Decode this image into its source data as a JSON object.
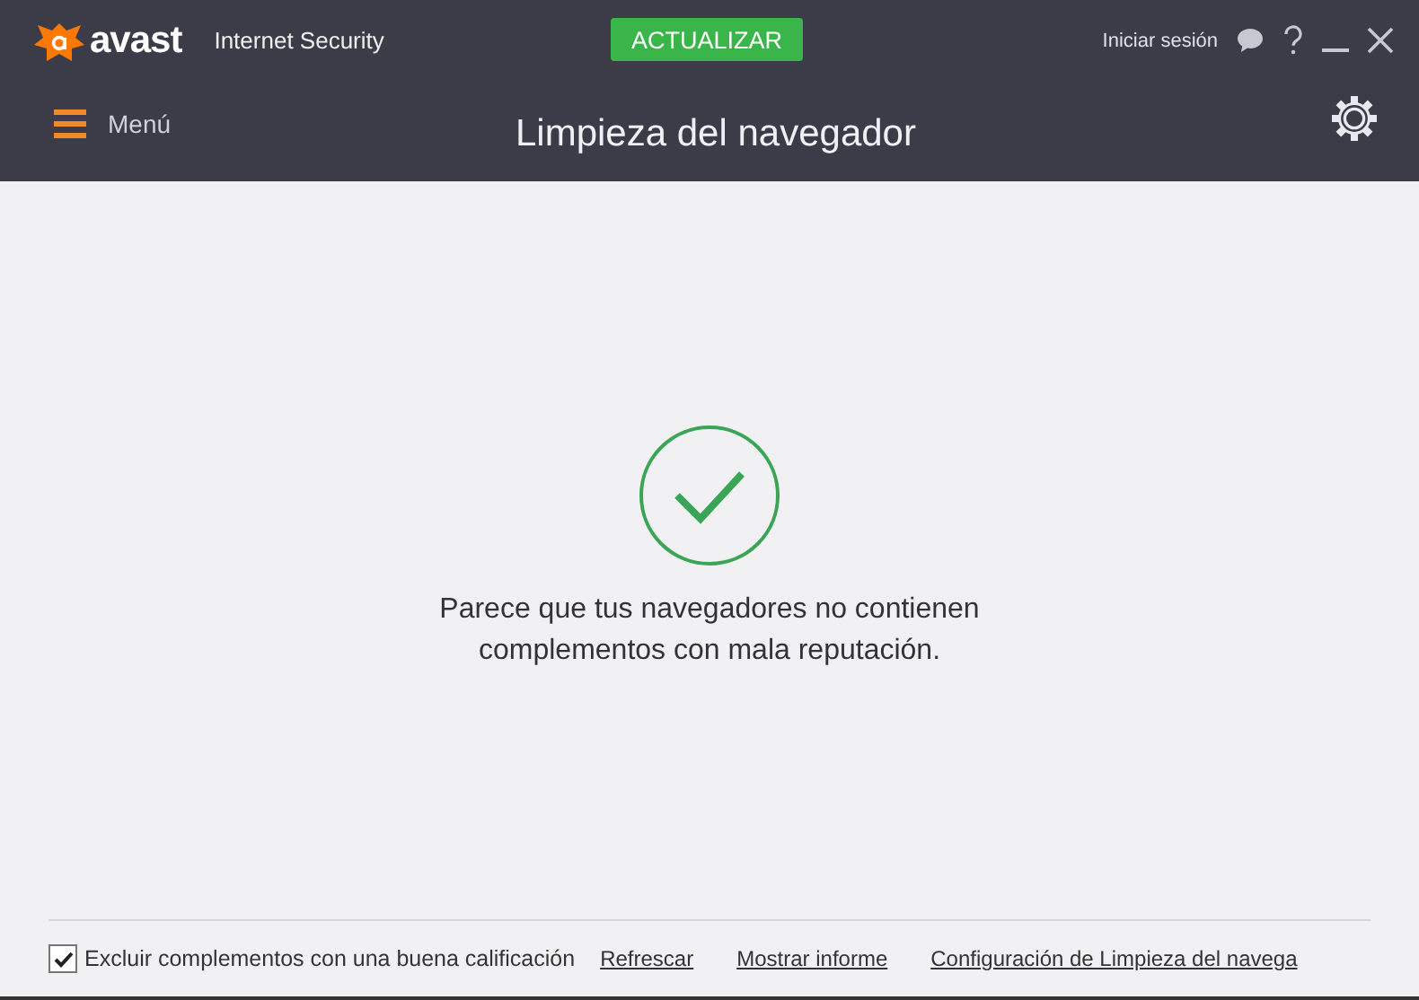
{
  "app": {
    "logo": "avast",
    "product": "Internet Security",
    "update_button": "ACTUALIZAR",
    "sign_in": "Iniciar sesión",
    "menu": "Menú",
    "title": "Limpieza del navegador"
  },
  "result": {
    "kind": "ok",
    "message": "Parece que tus navegadores no contienen complementos con mala reputación."
  },
  "footer": {
    "exclude": {
      "label": "Excluir complementos con una buena calificación",
      "checked": true
    },
    "links": [
      "Refrescar",
      "Mostrar informe",
      "Configuración de Limpieza del navega"
    ]
  }
}
